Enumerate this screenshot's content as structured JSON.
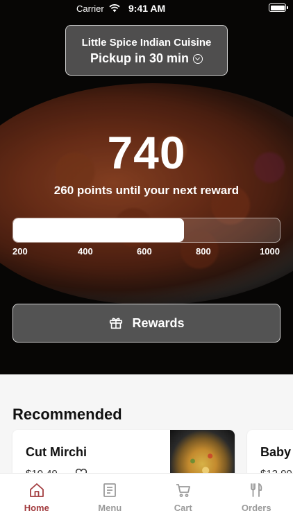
{
  "status_bar": {
    "carrier": "Carrier",
    "time": "9:41 AM"
  },
  "location": {
    "restaurant": "Little Spice Indian Cuisine",
    "pickup": "Pickup in 30 min"
  },
  "rewards": {
    "points": "740",
    "caption": "260 points until your next reward",
    "progress_fraction": 0.64,
    "ticks": [
      "200",
      "400",
      "600",
      "800",
      "1000"
    ],
    "button_label": "Rewards"
  },
  "recommended": {
    "title": "Recommended",
    "items": [
      {
        "name": "Cut Mirchi",
        "price": "$10.49"
      },
      {
        "name": "Baby",
        "price": "$12.99"
      }
    ]
  },
  "tabs": [
    {
      "label": "Home",
      "icon": "home-icon",
      "active": true
    },
    {
      "label": "Menu",
      "icon": "menu-icon",
      "active": false
    },
    {
      "label": "Cart",
      "icon": "cart-icon",
      "active": false
    },
    {
      "label": "Orders",
      "icon": "orders-icon",
      "active": false
    }
  ],
  "colors": {
    "accent": "#a23c3f",
    "tab_inactive": "#9a9a9a"
  }
}
